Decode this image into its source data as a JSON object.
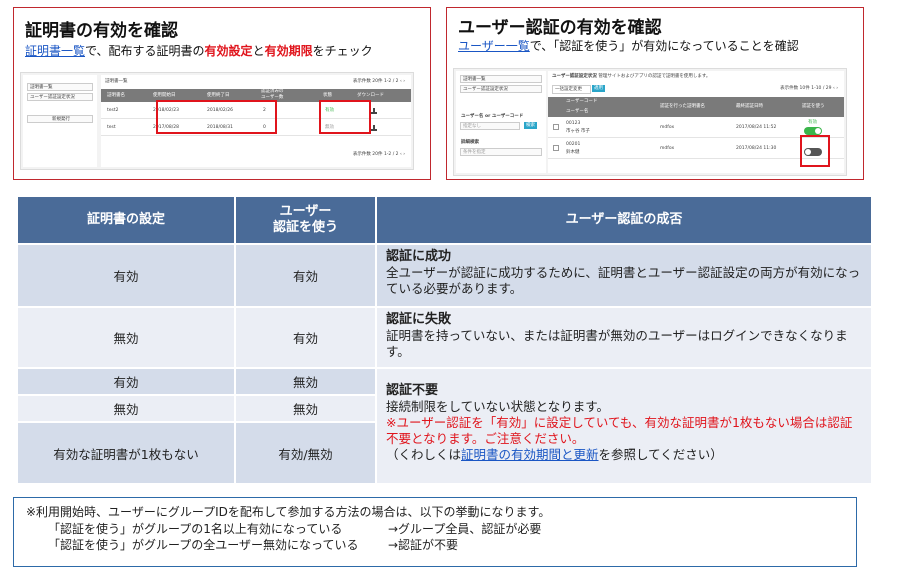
{
  "panel_left": {
    "title": "証明書の有効を確認",
    "sub_link": "証明書一覧",
    "sub_text1": "で、配布する証明書の",
    "sub_red1": "有効設定",
    "sub_text2": "と",
    "sub_red2": "有効期限",
    "sub_text3": "をチェック",
    "side_items": [
      "証明書一覧",
      "ユーザー認証設定状況"
    ],
    "side_button": "新規発行",
    "main_title": "証明書一覧",
    "pager_top": "表示件数",
    "pager_count": "20件",
    "pager_range": "1-2 / 2",
    "columns": [
      "証明書名",
      "使用開始日",
      "使用終了日",
      "認証済みの\nユーザー数",
      "状態",
      "ダウンロード"
    ],
    "rows": [
      {
        "name": "test2",
        "start": "2018/02/23",
        "end": "2018/02/26",
        "users": "2",
        "status": "有効"
      },
      {
        "name": "test",
        "start": "2017/08/28",
        "end": "2018/08/31",
        "users": "0",
        "status": "無効"
      }
    ],
    "pager_bottom": "表示件数",
    "pager_bottom_count": "20件",
    "pager_bottom_range": "1-2 / 2"
  },
  "panel_right": {
    "title": "ユーザー認証の有効を確認",
    "sub_link": "ユーザー一覧",
    "sub_text": "で、「認証を使う」が有効になっていることを確認",
    "side_items": [
      "証明書一覧",
      "ユーザー認証設定状況"
    ],
    "main_title": "ユーザー認証設定状況",
    "main_note": "管理サイトおよびアプリの認証で証明書を使用します。",
    "bulk_select": "一括設定変更",
    "apply": "適用",
    "search_label": "ユーザー名 or ユーザーコード",
    "search_placeholder": "指定なし",
    "search_button": "検索",
    "detail_label": "詳細検索",
    "detail_value": "条件を指定",
    "pager": "表示件数",
    "pager_count": "10件",
    "pager_range": "1-10 / 29",
    "columns": [
      "ユーザーコード",
      "ユーザー名",
      "認証を行った証明書名",
      "最終認証日時",
      "認証を使う"
    ],
    "rows": [
      {
        "code": "00123",
        "name": "市ヶ谷 市子",
        "cert": "mdfox",
        "date": "2017/08/24 11:52",
        "toggle_label": "有効",
        "on": true
      },
      {
        "code": "00201",
        "name": "鈴木健",
        "cert": "mdfox",
        "date": "2017/08/24 11:30",
        "toggle_label": "",
        "on": false
      }
    ]
  },
  "table": {
    "headers": [
      "証明書の設定",
      "ユーザー\n認証を使う",
      "ユーザー認証の成否"
    ],
    "rows": [
      {
        "cert": "有効",
        "user": "有効"
      },
      {
        "cert": "無効",
        "user": "有効"
      },
      {
        "cert": "有効",
        "user": "無効"
      },
      {
        "cert": "無効",
        "user": "無効"
      },
      {
        "cert": "有効な証明書が1枚もない",
        "user": "有効/無効"
      }
    ],
    "desc1_title": "認証に成功",
    "desc1_body": "全ユーザーが認証に成功するために、証明書とユーザー認証設定の両方が有効になっている必要があります。",
    "desc2_title": "認証に失敗",
    "desc2_body": "証明書を持っていない、または証明書が無効のユーザーはログインできなくなります。",
    "desc3_title": "認証不要",
    "desc3_body": "接続制限をしていない状態となります。",
    "desc3_red": "※ユーザー認証を「有効」に設定していても、有効な証明書が1枚もない場合は認証不要となります。ご注意ください。",
    "desc3_ref_pre": "（くわしくは",
    "desc3_ref_link": "証明書の有効期間と更新",
    "desc3_ref_post": "を参照してください）"
  },
  "note": {
    "line1": "※利用開始時、ユーザーにグループIDを配布して参加する方法の場合は、以下の挙動になります。",
    "line2a": "「認証を使う」がグループの1名以上有効になっている",
    "line2b": "→グループ全員、認証が必要",
    "line3a": "「認証を使う」がグループの全ユーザー無効になっている",
    "line3b": "→認証が不要"
  },
  "colors": {
    "accent_red": "#e0141c",
    "link": "#1a56c4",
    "header": "#4a6b98",
    "row_dark": "#d4dcea",
    "row_light": "#ebeef5",
    "note_border": "#2d6aa8"
  }
}
